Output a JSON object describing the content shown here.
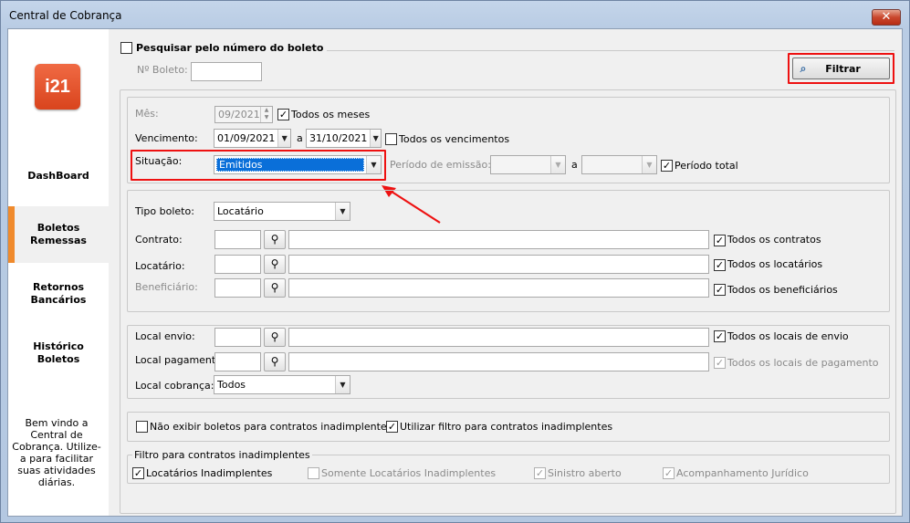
{
  "window": {
    "title": "Central de Cobrança",
    "close": "✕"
  },
  "sidebar": {
    "logo": "i21",
    "items": [
      {
        "label": "DashBoard"
      },
      {
        "label": "Boletos\nRemessas"
      },
      {
        "label": "Retornos\nBancários"
      },
      {
        "label": "Histórico\nBoletos"
      }
    ],
    "welcome": "Bem vindo a Central de Cobrança. Utilize-a para facilitar suas atividades diárias."
  },
  "search": {
    "title": "Pesquisar pelo número do boleto",
    "boleto_label": "Nº Boleto:",
    "boleto_value": "",
    "filter_label": "Filtrar"
  },
  "period": {
    "mes_label": "Mês:",
    "mes_value": "09/2021",
    "todos_meses": "Todos os meses",
    "venc_label": "Vencimento:",
    "venc_from": "01/09/2021",
    "venc_sep": "a",
    "venc_to": "31/10/2021",
    "todos_venc": "Todos os vencimentos",
    "situacao_label": "Situação:",
    "situacao_value": "Emitidos",
    "emissao_label": "Período de emissão:",
    "emissao_sep": "a",
    "periodo_total": "Período total"
  },
  "parties": {
    "tipo_label": "Tipo boleto:",
    "tipo_value": "Locatário",
    "contrato_label": "Contrato:",
    "todos_contratos": "Todos os contratos",
    "locatario_label": "Locatário:",
    "todos_locatarios": "Todos os locatários",
    "beneficiario_label": "Beneficiário:",
    "todos_beneficiarios": "Todos os beneficiários"
  },
  "local": {
    "envio_label": "Local envio:",
    "todos_envio": "Todos os locais de envio",
    "pagamento_label": "Local pagamento",
    "todos_pagamento": "Todos os locais de pagamento",
    "cobranca_label": "Local cobrança:",
    "cobranca_value": "Todos"
  },
  "options": {
    "nao_exibir": "Não exibir boletos para contratos inadimplentes",
    "utilizar_filtro": "Utilizar filtro para contratos inadimplentes"
  },
  "inadimplentes": {
    "title": "Filtro para contratos inadimplentes",
    "locatarios": "Locatários Inadimplentes",
    "somente": "Somente Locatários Inadimplentes",
    "sinistro": "Sinistro aberto",
    "acompanhamento": "Acompanhamento Jurídico"
  },
  "checks": {
    "mark": "✓"
  },
  "colors": {
    "accent": "#f08a2c",
    "highlight": "#e11111",
    "selection": "#0a6fd9"
  }
}
